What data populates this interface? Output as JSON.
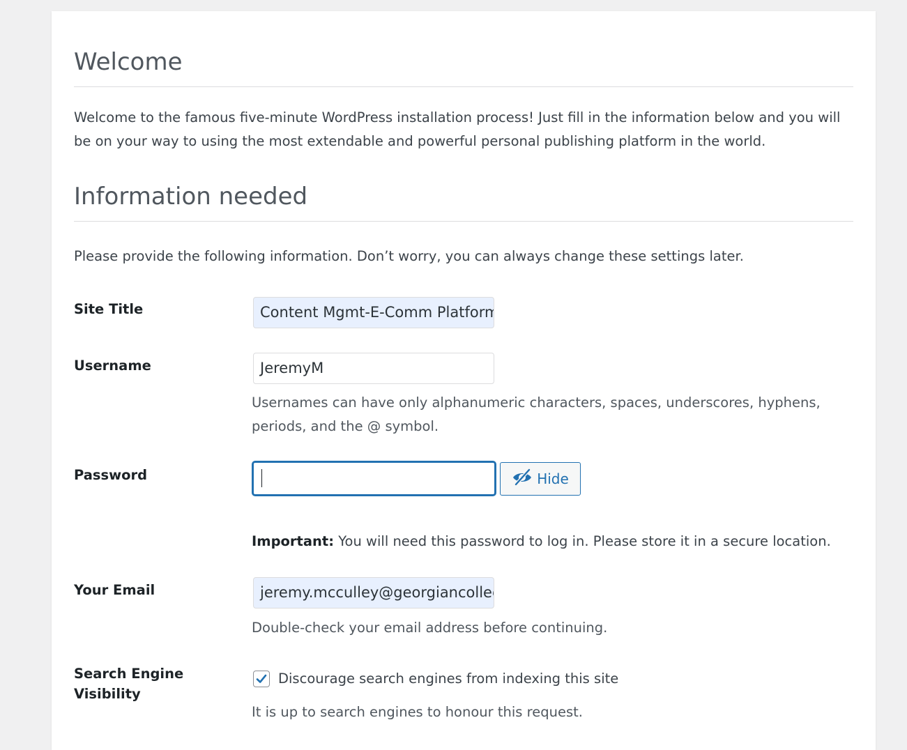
{
  "welcome": {
    "title": "Welcome",
    "intro": "Welcome to the famous five-minute WordPress installation process! Just fill in the information below and you will be on your way to using the most extendable and powerful personal publishing platform in the world."
  },
  "info": {
    "title": "Information needed",
    "intro": "Please provide the following information. Don’t worry, you can always change these settings later."
  },
  "fields": {
    "site_title": {
      "label": "Site Title",
      "value": "Content Mgmt-E-Comm Platform"
    },
    "username": {
      "label": "Username",
      "value": "JeremyM",
      "hint": "Usernames can have only alphanumeric characters, spaces, underscores, hyphens, periods, and the @ symbol."
    },
    "password": {
      "label": "Password",
      "value": "",
      "toggle_label": "Hide",
      "toggle_icon": "eye-slash-icon",
      "important_label": "Important:",
      "important_text": " You will need this password to log in. Please store it in a secure location."
    },
    "email": {
      "label": "Your Email",
      "value": "jeremy.mcculley@georgiancollege.ca",
      "hint": "Double-check your email address before continuing."
    },
    "search_visibility": {
      "label_line1": "Search Engine",
      "label_line2": "Visibility",
      "checkbox_label": "Discourage search engines from indexing this site",
      "checked": true,
      "hint": "It is up to search engines to honour this request."
    }
  },
  "colors": {
    "accent": "#2271b1",
    "autofill": "#e8f0fe",
    "background": "#f0f0f1"
  }
}
